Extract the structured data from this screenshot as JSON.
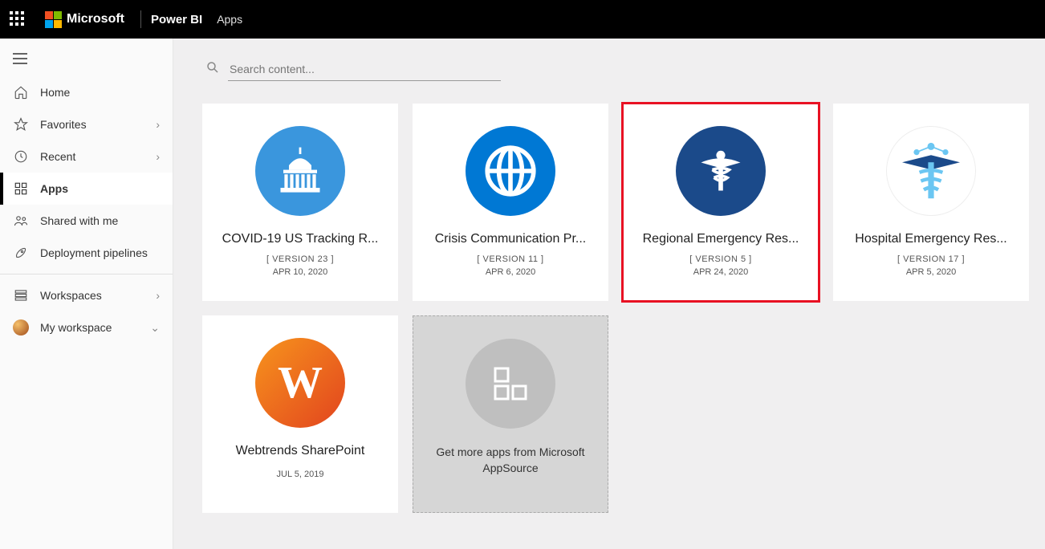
{
  "header": {
    "brand_company": "Microsoft",
    "brand_product": "Power BI",
    "breadcrumb": "Apps"
  },
  "sidebar": {
    "items": [
      {
        "label": "Home",
        "icon": "home-icon",
        "chevron": false
      },
      {
        "label": "Favorites",
        "icon": "star-icon",
        "chevron": true
      },
      {
        "label": "Recent",
        "icon": "clock-icon",
        "chevron": true
      },
      {
        "label": "Apps",
        "icon": "apps-icon",
        "chevron": false,
        "active": true
      },
      {
        "label": "Shared with me",
        "icon": "shared-icon",
        "chevron": false
      },
      {
        "label": "Deployment pipelines",
        "icon": "rocket-icon",
        "chevron": false
      }
    ],
    "workspaces_label": "Workspaces",
    "my_workspace_label": "My workspace"
  },
  "search": {
    "placeholder": "Search content..."
  },
  "apps": [
    {
      "title": "COVID-19 US Tracking R...",
      "version": "[ VERSION 23 ]",
      "date": "APR 10, 2020",
      "icon": "capitol"
    },
    {
      "title": "Crisis Communication Pr...",
      "version": "[ VERSION 11 ]",
      "date": "APR 6, 2020",
      "icon": "globe"
    },
    {
      "title": "Regional Emergency Res...",
      "version": "[ VERSION 5 ]",
      "date": "APR 24, 2020",
      "icon": "caduceus-dark",
      "highlight": true
    },
    {
      "title": "Hospital Emergency Res...",
      "version": "[ VERSION 17 ]",
      "date": "APR 5, 2020",
      "icon": "caduceus-light"
    },
    {
      "title": "Webtrends SharePoint",
      "version": "",
      "date": "JUL 5, 2019",
      "icon": "w-orange"
    }
  ],
  "get_more": {
    "title": "Get more apps from Microsoft AppSource"
  }
}
